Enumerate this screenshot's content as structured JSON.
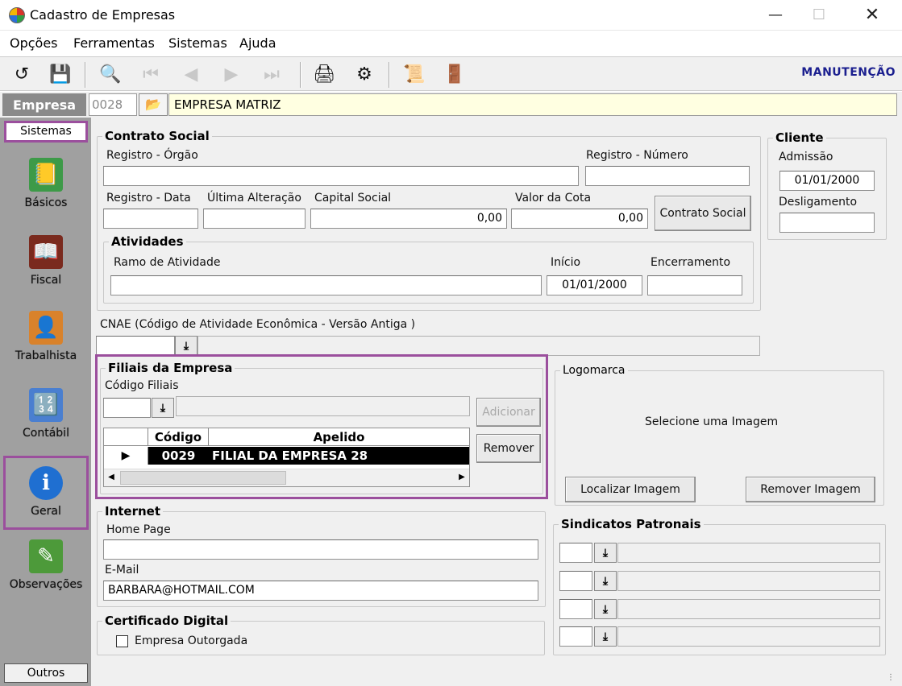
{
  "window": {
    "title": "Cadastro de Empresas"
  },
  "menu": [
    "Opções",
    "Ferramentas",
    "Sistemas",
    "Ajuda"
  ],
  "toolbar": {
    "mode": "MANUTENÇÃO"
  },
  "empresa": {
    "label": "Empresa",
    "code": "0028",
    "name": "EMPRESA MATRIZ"
  },
  "sidebar": {
    "header": "Sistemas",
    "items": [
      {
        "label": "Básicos",
        "icon": "notebook-icon"
      },
      {
        "label": "Fiscal",
        "icon": "ledger-book-icon"
      },
      {
        "label": "Trabalhista",
        "icon": "worker-document-icon"
      },
      {
        "label": "Contábil",
        "icon": "calculator-icon"
      },
      {
        "label": "Geral",
        "icon": "monitor-info-icon"
      },
      {
        "label": "Observações",
        "icon": "pencil-paper-icon"
      }
    ],
    "footer": "Outros"
  },
  "contrato": {
    "legend": "Contrato Social",
    "registro_orgao_label": "Registro - Órgão",
    "registro_orgao": "",
    "registro_numero_label": "Registro - Número",
    "registro_numero": "",
    "registro_data_label": "Registro - Data",
    "registro_data": "",
    "ultima_alteracao_label": "Última Alteração",
    "ultima_alteracao": "",
    "capital_social_label": "Capital Social",
    "capital_social": "0,00",
    "valor_cota_label": "Valor da Cota",
    "valor_cota": "0,00",
    "button": "Contrato Social"
  },
  "atividades": {
    "legend": "Atividades",
    "ramo_label": "Ramo de Atividade",
    "ramo": "",
    "inicio_label": "Início",
    "inicio": "01/01/2000",
    "encerramento_label": "Encerramento",
    "encerramento": ""
  },
  "cliente": {
    "legend": "Cliente",
    "admissao_label": "Admissão",
    "admissao": "01/01/2000",
    "desligamento_label": "Desligamento",
    "desligamento": ""
  },
  "cnae": {
    "label": "CNAE (Código de Atividade Econômica - Versão Antiga )",
    "value": ""
  },
  "filiais": {
    "legend": "Filiais da Empresa",
    "codigo_label": "Código Filiais",
    "add_button": "Adicionar",
    "remove_button": "Remover",
    "columns": [
      "Código",
      "Apelido"
    ],
    "rows": [
      {
        "codigo": "0029",
        "apelido": "FILIAL DA EMPRESA 28"
      }
    ]
  },
  "logomarca": {
    "legend": "Logomarca",
    "placeholder": "Selecione  uma  Imagem",
    "locate_button": "Localizar Imagem",
    "remove_button": "Remover Imagem"
  },
  "internet": {
    "legend": "Internet",
    "homepage_label": "Home Page",
    "homepage": "",
    "email_label": "E-Mail",
    "email": "BARBARA@HOTMAIL.COM"
  },
  "sindicatos": {
    "legend": "Sindicatos Patronais"
  },
  "certificado": {
    "legend": "Certificado Digital",
    "checkbox_label": "Empresa Outorgada",
    "checked": false
  },
  "colors": {
    "highlight_border": "#9b4f9d",
    "sidebar_bg": "#a0a0a0",
    "mode_text": "#1b1f8f",
    "name_bg": "#ffffe1"
  }
}
